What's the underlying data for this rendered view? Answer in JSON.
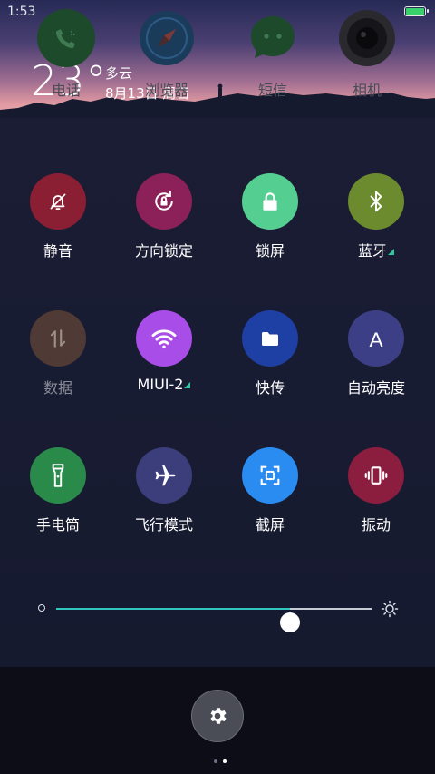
{
  "status_bar": {
    "time": "1:53",
    "battery_color": "#39d16a"
  },
  "weather": {
    "temperature": "23°",
    "condition": "多云",
    "date": "8月13日 周日"
  },
  "tiles": [
    {
      "label": "静音",
      "icon": "bell-off-icon",
      "color": "#8a1f33",
      "dim": false,
      "expandable": false
    },
    {
      "label": "方向锁定",
      "icon": "rotation-lock-icon",
      "color": "#8b2158",
      "dim": false,
      "expandable": false
    },
    {
      "label": "锁屏",
      "icon": "padlock-icon",
      "color": "#54cf91",
      "dim": false,
      "expandable": false
    },
    {
      "label": "蓝牙",
      "icon": "bluetooth-icon",
      "color": "#6b8b2e",
      "dim": false,
      "expandable": true
    },
    {
      "label": "数据",
      "icon": "data-arrows-icon",
      "color": "#4f3a35",
      "dim": true,
      "expandable": false
    },
    {
      "label": "MIUI-2",
      "icon": "wifi-icon",
      "color": "#a84de8",
      "dim": false,
      "expandable": true
    },
    {
      "label": "快传",
      "icon": "folder-icon",
      "color": "#1e3fa3",
      "dim": false,
      "expandable": false
    },
    {
      "label": "自动亮度",
      "icon": "auto-brightness-icon",
      "color": "#3d3f86",
      "dim": false,
      "expandable": false
    },
    {
      "label": "手电筒",
      "icon": "flashlight-icon",
      "color": "#2a8a4a",
      "dim": false,
      "expandable": false
    },
    {
      "label": "飞行模式",
      "icon": "airplane-icon",
      "color": "#3b3e7a",
      "dim": false,
      "expandable": false
    },
    {
      "label": "截屏",
      "icon": "screenshot-icon",
      "color": "#2a8cf0",
      "dim": false,
      "expandable": false
    },
    {
      "label": "振动",
      "icon": "vibrate-icon",
      "color": "#8b1d3f",
      "dim": false,
      "expandable": false
    }
  ],
  "brightness": {
    "level": 0.74,
    "fill_color": "#2fc6c0"
  },
  "dock": [
    {
      "label": "电话",
      "icon": "phone-icon",
      "color": "#1d4a2a"
    },
    {
      "label": "浏览器",
      "icon": "compass-icon",
      "color": "#1b3b5a"
    },
    {
      "label": "短信",
      "icon": "message-icon",
      "color": "#1d4a2a"
    },
    {
      "label": "相机",
      "icon": "camera-icon",
      "color": "#2a2a2e"
    }
  ],
  "settings_button": {
    "icon": "gear-icon"
  },
  "page_indicator": {
    "count": 2,
    "active": 1
  }
}
